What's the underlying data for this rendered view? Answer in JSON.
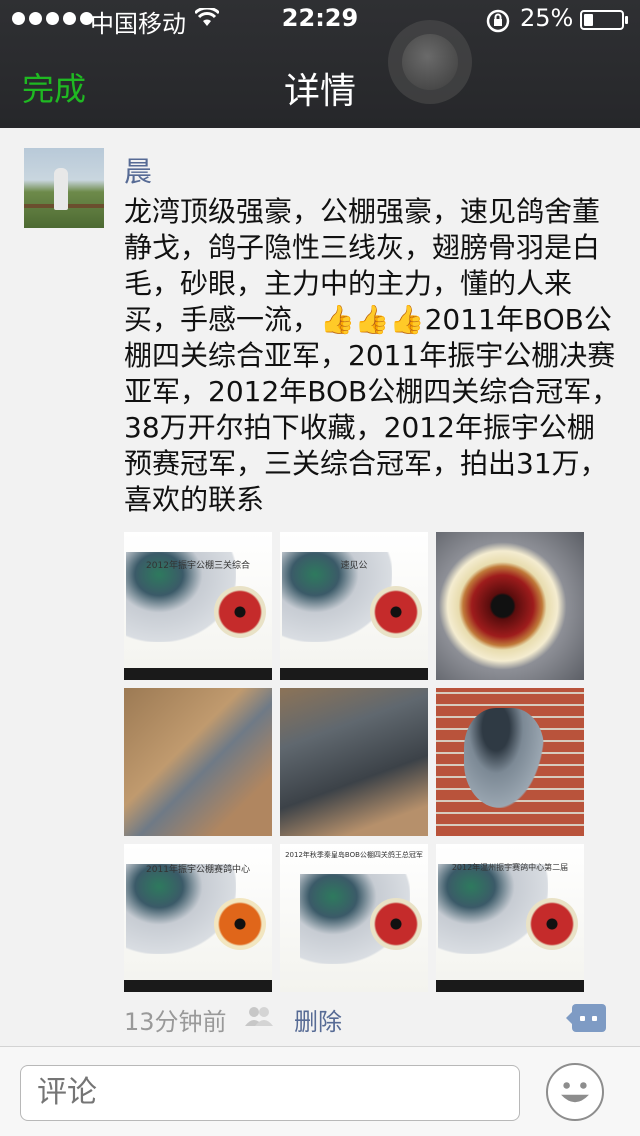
{
  "status_bar": {
    "carrier": "中国移动",
    "time": "22:29",
    "battery_percent": "25%",
    "battery_level": 0.25
  },
  "nav": {
    "done_label": "完成",
    "title": "详情"
  },
  "post": {
    "author": "晨",
    "text": "龙湾顶级强豪，公棚强豪，速见鸽舍董静戈，鸽子隐性三线灰，翅膀骨羽是白毛，砂眼，主力中的主力，懂的人来买，手感一流，👍👍👍2011年BOB公棚四关综合亚军，2011年振宇公棚决赛亚军，2012年BOB公棚四关综合冠军，38万开尔拍下收藏，2012年振宇公棚预赛冠军，三关综合冠军，拍出31万，喜欢的联系",
    "photos": [
      {
        "caption": "2012年振宇公棚三关综合"
      },
      {
        "caption": "速见公"
      },
      {
        "caption": ""
      },
      {
        "caption": ""
      },
      {
        "caption": ""
      },
      {
        "caption": ""
      },
      {
        "caption": "2011年振宇公棚赛鸽中心"
      },
      {
        "caption": "2012年秋季秦皇岛BOB公棚四关鸽王总冠军"
      },
      {
        "caption": "2012年温州振宇赛鸽中心第二届"
      }
    ],
    "time_ago": "13分钟前",
    "delete_label": "删除"
  },
  "comment_bar": {
    "placeholder": "评论"
  },
  "colors": {
    "accent_green": "#1fb922",
    "link_blue": "#576b95",
    "nav_bg": "#2f3033"
  }
}
